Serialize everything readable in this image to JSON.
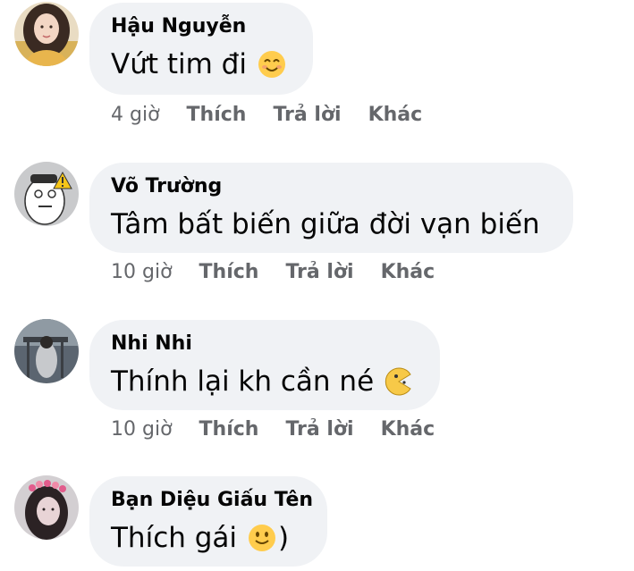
{
  "comments": [
    {
      "author": "Hậu Nguyễn",
      "text": "Vứt tim đi",
      "emoji": "smiling-eyes-emoji",
      "time": "4 giờ",
      "like": "Thích",
      "reply": "Trả lời",
      "more": "Khác"
    },
    {
      "author": "Võ Trường",
      "text": "Tâm bất biến giữa đời vạn biến",
      "time": "10 giờ",
      "like": "Thích",
      "reply": "Trả lời",
      "more": "Khác"
    },
    {
      "author": "Nhi Nhi",
      "text": "Thính lại kh cần né",
      "emoji": "pacman-emoticon",
      "time": "10 giờ",
      "like": "Thích",
      "reply": "Trả lời",
      "more": "Khác"
    },
    {
      "author": "Bạn Diệu Giấu Tên",
      "text": "Thích gái",
      "emoji": "slightly-smiling-emoji",
      "suffix": ")"
    }
  ]
}
